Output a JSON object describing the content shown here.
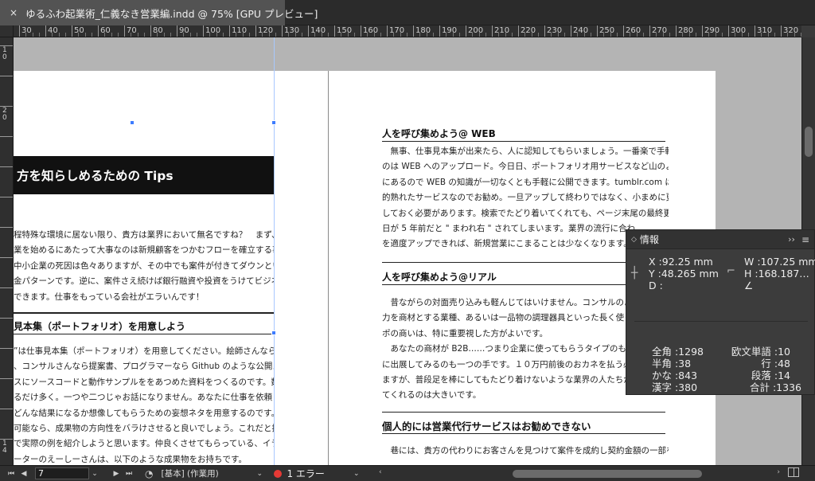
{
  "tab": {
    "close": "×",
    "title": "ゆるふわ起業術_仁義なき営業編.indd @ 75% [GPU プレビュー]"
  },
  "ruler": {
    "h_labels": [
      "30",
      "40",
      "50",
      "60",
      "70",
      "80",
      "90",
      "100",
      "110",
      "120",
      "130",
      "140",
      "150",
      "160",
      "170",
      "180",
      "190",
      "200",
      "210",
      "220",
      "230",
      "240",
      "250",
      "260",
      "270",
      "280",
      "290",
      "300",
      "310",
      "320"
    ],
    "v_labels": [
      "10",
      "",
      "20",
      "",
      "",
      "",
      "",
      "",
      "",
      "",
      "",
      "",
      "",
      "14"
    ]
  },
  "left_page": {
    "heading": "方を知らしめるための Tips",
    "para1": [
      "程特殊な環境に居ない限り、貴方は業界において無名ですね？　まず、営",
      "業を始めるにあたって大事なのは新規顧客をつかむフローを確立する事",
      "中小企業の死因は色々ありますが、その中でも案件が付きてダウンという",
      "金パターンです。逆に、案件さえ続けば銀行融資や投資をうけてビジネス",
      "できます。仕事をもっている会社がエラいんです！"
    ],
    "subhead": "見本集（ポートフォリオ）を用意しよう",
    "para2": [
      "”は仕事見本集（ポートフォリオ）を用意してください。絵師さんなら、イ",
      "、コンサルさんなら提案書、プログラマーなら Github のような公開ス",
      "スにソースコードと動作サンプルををあつめた資料をつくるのです。数",
      "るだけ多く。一つや二つじゃお話になりません。あなたに仕事を依頼し",
      "どんな結果になるか想像してもらうための妄想ネタを用意するのです。",
      "可能なら、成果物の方向性をバラけさせると良いでしょう。これだと抽象",
      "で実際の例を紹介しようと思います。仲良くさせてもらっている、イラス",
      "ーターのえーしーさんは、以下のような成果物をお持ちです。"
    ]
  },
  "right_page": {
    "section1_title": "人を呼び集めよう@ WEB",
    "section1_body": [
      "　無事、仕事見本集が出来たら、人に認知してもらいましょう。一番楽で手軽な",
      "のは WEB へのアップロード。今日日、ポートフォリオ用サービスなど山のよう",
      "にあるので WEB の知識が一切なくとも手軽に公開できます。tumblr.com は比較",
      "的熟れたサービスなのでお勧め。一旦アップして終わりではなく、小まめに更新",
      "しておく必要があります。検索でたどり着いてくれても、ページ末尾の最終更新",
      "日が 5 年前だと \" まわれ右 \" されてしまいます。業界の流行に合わ",
      "を適度アップできれば、新規営業にこまることは少なくなります。"
    ],
    "section2_title": "人を呼び集めよう@リアル",
    "section2_body": [
      "　昔ながらの対面売り込みも軽んじてはいけません。コンサルのよ",
      "力を商材とする業種、あるいは一品物の調理器具といった長く使って",
      "ポの商いは、特に重要視した方がよいです。",
      "　あなたの商材が B2B……つまり企業に使ってもらうタイプのもの",
      "に出展してみるのも一つの手です。１０万円前後のおカネを払う必",
      "ますが、普段足を棒にしてもたどり着けないような業界の人たちが自",
      "てくれるのは大きいです。"
    ],
    "section3_title": "個人的には営業代行サービスはお勧めできない",
    "section3_body": [
      "　巷には、貴方の代わりにお客さんを見つけて案件を成約し契約金額の一部を報"
    ]
  },
  "info_panel": {
    "collapse": "◇",
    "title": "情報",
    "expand": "››",
    "menu": "≡",
    "x": "X :92.25 mm",
    "y": "Y :48.265 mm",
    "d": "D :",
    "w": "W :107.25 mm",
    "h": "H :168.187…",
    "angle": "∠",
    "zenkaku": "全角 :1298",
    "hankaku": "半角 :38",
    "kana": "かな :843",
    "kanji": "漢字 :380",
    "word": "欧文単語 :10",
    "lines": "行 :48",
    "paragraphs": "段落 :14",
    "total": "合計 :1336"
  },
  "statusbar": {
    "first": "⏮",
    "prev": "◀",
    "page": "7",
    "dropdown": "⌄",
    "next": "▶",
    "last": "⏭",
    "preflight": "◔",
    "profile": "[基本] (作業用)",
    "profile_dropdown": "⌄",
    "error": "1 エラー",
    "error_dropdown": "⌄",
    "scroll_left": "‹",
    "scroll_right": "›"
  },
  "colors": {
    "accent": "#3d7cff",
    "error": "#e53935",
    "panel_bg": "#3c3c3c",
    "pasteboard": "#b4b4b4"
  }
}
